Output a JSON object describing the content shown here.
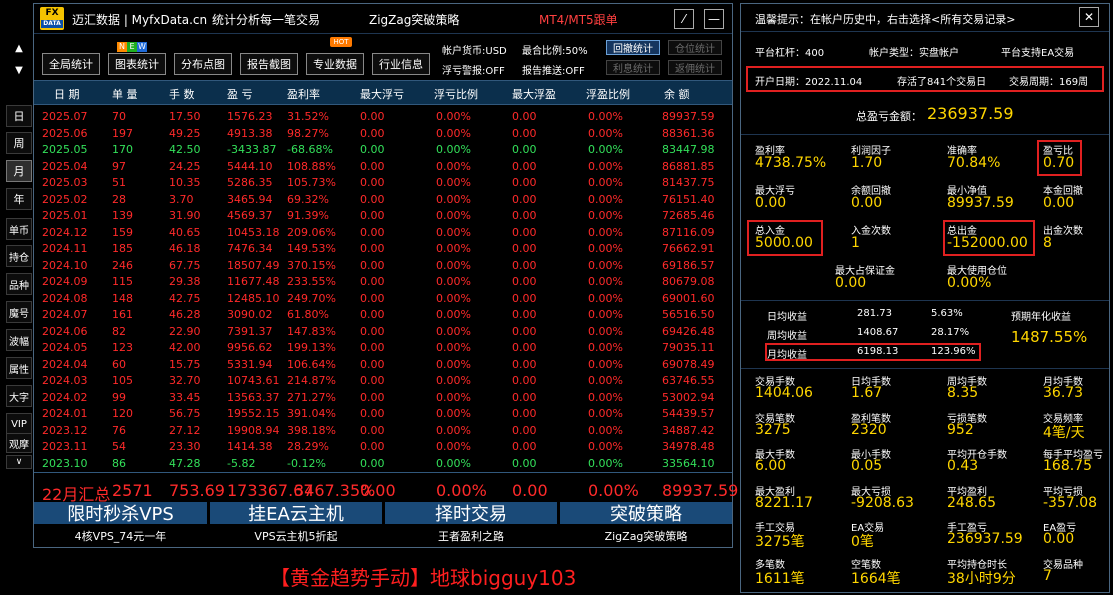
{
  "nav": {
    "up": "▲",
    "down": "▼",
    "items": [
      "日",
      "周",
      "月",
      "年",
      "单币",
      "持仓",
      "品种",
      "魔号",
      "波幅",
      "属性",
      "大字",
      "VIP",
      "观摩"
    ],
    "more": "∨"
  },
  "title": {
    "brand": "迈汇数据 | MyfxData.cn",
    "slogan": "统计分析每一笔交易",
    "strategy": "ZigZag突破策略",
    "mt": "MT4/MT5跟单",
    "minimize": "⁄",
    "maximize": "—"
  },
  "logo": {
    "top": "FX",
    "bottom": "DATA"
  },
  "toolbar": {
    "buttons": [
      "全局统计",
      "图表统计",
      "分布点图",
      "报告截图",
      "专业数据",
      "行业信息"
    ],
    "new_badge": [
      "N",
      "E",
      "W"
    ],
    "hot_badge": "HOT",
    "currency": "帐户货币:USD",
    "ratio": "最合比例:50%",
    "floatwarn": "浮亏警报:OFF",
    "report": "报告推送:OFF",
    "small_buttons": [
      "回撤统计",
      "仓位统计",
      "利息统计",
      "返佣统计"
    ]
  },
  "table": {
    "headers": [
      "日 期",
      "单 量",
      "手 数",
      "盈 亏",
      "盈利率",
      "最大浮亏",
      "浮亏比例",
      "最大浮盈",
      "浮盈比例",
      "余 额"
    ],
    "rows": [
      [
        "2025.07",
        "70",
        "17.50",
        "1576.23",
        "31.52%",
        "0.00",
        "0.00%",
        "0.00",
        "0.00%",
        "89937.59",
        "red"
      ],
      [
        "2025.06",
        "197",
        "49.25",
        "4913.38",
        "98.27%",
        "0.00",
        "0.00%",
        "0.00",
        "0.00%",
        "88361.36",
        "red"
      ],
      [
        "2025.05",
        "170",
        "42.50",
        "-3433.87",
        "-68.68%",
        "0.00",
        "0.00%",
        "0.00",
        "0.00%",
        "83447.98",
        "green"
      ],
      [
        "2025.04",
        "97",
        "24.25",
        "5444.10",
        "108.88%",
        "0.00",
        "0.00%",
        "0.00",
        "0.00%",
        "86881.85",
        "red"
      ],
      [
        "2025.03",
        "51",
        "10.35",
        "5286.35",
        "105.73%",
        "0.00",
        "0.00%",
        "0.00",
        "0.00%",
        "81437.75",
        "red"
      ],
      [
        "2025.02",
        "28",
        "3.70",
        "3465.94",
        "69.32%",
        "0.00",
        "0.00%",
        "0.00",
        "0.00%",
        "76151.40",
        "red"
      ],
      [
        "2025.01",
        "139",
        "31.90",
        "4569.37",
        "91.39%",
        "0.00",
        "0.00%",
        "0.00",
        "0.00%",
        "72685.46",
        "red"
      ],
      [
        "2024.12",
        "159",
        "40.65",
        "10453.18",
        "209.06%",
        "0.00",
        "0.00%",
        "0.00",
        "0.00%",
        "87116.09",
        "red"
      ],
      [
        "2024.11",
        "185",
        "46.18",
        "7476.34",
        "149.53%",
        "0.00",
        "0.00%",
        "0.00",
        "0.00%",
        "76662.91",
        "red"
      ],
      [
        "2024.10",
        "246",
        "67.75",
        "18507.49",
        "370.15%",
        "0.00",
        "0.00%",
        "0.00",
        "0.00%",
        "69186.57",
        "red"
      ],
      [
        "2024.09",
        "115",
        "29.38",
        "11677.48",
        "233.55%",
        "0.00",
        "0.00%",
        "0.00",
        "0.00%",
        "80679.08",
        "red"
      ],
      [
        "2024.08",
        "148",
        "42.75",
        "12485.10",
        "249.70%",
        "0.00",
        "0.00%",
        "0.00",
        "0.00%",
        "69001.60",
        "red"
      ],
      [
        "2024.07",
        "161",
        "46.28",
        "3090.02",
        "61.80%",
        "0.00",
        "0.00%",
        "0.00",
        "0.00%",
        "56516.50",
        "red"
      ],
      [
        "2024.06",
        "82",
        "22.90",
        "7391.37",
        "147.83%",
        "0.00",
        "0.00%",
        "0.00",
        "0.00%",
        "69426.48",
        "red"
      ],
      [
        "2024.05",
        "123",
        "42.00",
        "9956.62",
        "199.13%",
        "0.00",
        "0.00%",
        "0.00",
        "0.00%",
        "79035.11",
        "red"
      ],
      [
        "2024.04",
        "60",
        "15.75",
        "5331.94",
        "106.64%",
        "0.00",
        "0.00%",
        "0.00",
        "0.00%",
        "69078.49",
        "red"
      ],
      [
        "2024.03",
        "105",
        "32.70",
        "10743.61",
        "214.87%",
        "0.00",
        "0.00%",
        "0.00",
        "0.00%",
        "63746.55",
        "red"
      ],
      [
        "2024.02",
        "99",
        "33.45",
        "13563.37",
        "271.27%",
        "0.00",
        "0.00%",
        "0.00",
        "0.00%",
        "53002.94",
        "red"
      ],
      [
        "2024.01",
        "120",
        "56.75",
        "19552.15",
        "391.04%",
        "0.00",
        "0.00%",
        "0.00",
        "0.00%",
        "54439.57",
        "red"
      ],
      [
        "2023.12",
        "76",
        "27.12",
        "19908.94",
        "398.18%",
        "0.00",
        "0.00%",
        "0.00",
        "0.00%",
        "34887.42",
        "red"
      ],
      [
        "2023.11",
        "54",
        "23.30",
        "1414.38",
        "28.29%",
        "0.00",
        "0.00%",
        "0.00",
        "0.00%",
        "34978.48",
        "red"
      ],
      [
        "2023.10",
        "86",
        "47.28",
        "-5.82",
        "-0.12%",
        "0.00",
        "0.00%",
        "0.00",
        "0.00%",
        "33564.10",
        "green"
      ]
    ],
    "summary": [
      "22月汇总",
      "2571",
      "753.69",
      "173367.67",
      "3467.35%",
      "0.00",
      "0.00%",
      "0.00",
      "0.00%",
      "89937.59"
    ]
  },
  "promo": [
    {
      "title": "限时秒杀VPS",
      "sub": "4核VPS_74元一年"
    },
    {
      "title": "挂EA云主机",
      "sub": "VPS云主机5折起"
    },
    {
      "title": "择时交易",
      "sub": "王者盈利之路"
    },
    {
      "title": "突破策略",
      "sub": "ZigZag突破策略"
    }
  ],
  "bottom_text": "【黄金趋势手动】地球bigguy103",
  "right": {
    "tip": "温馨提示：在帐户历史中，右击选择<所有交易记录>",
    "close": "✕",
    "leverage": "平台杠杆：400",
    "account_type": "帐户类型：实盘帐户",
    "ea_support": "平台支持EA交易",
    "open_date": "开户日期：2022.11.04",
    "history": "存活了841个交易日",
    "cycle": "交易周期：169周",
    "total_profit_label": "总盈亏金额：",
    "total_profit": "236937.59",
    "grid1": [
      [
        "盈利率",
        "4738.75%"
      ],
      [
        "利润因子",
        "1.70"
      ],
      [
        "准确率",
        "70.84%"
      ],
      [
        "盈亏比",
        "0.70"
      ],
      [
        "最大浮亏",
        "0.00"
      ],
      [
        "余额回撤",
        "0.00"
      ],
      [
        "最小净值",
        "89937.59"
      ],
      [
        "本金回撤",
        "0.00"
      ],
      [
        "总入金",
        "5000.00"
      ],
      [
        "入金次数",
        "1"
      ],
      [
        "总出金",
        "-152000.00"
      ],
      [
        "出金次数",
        "8"
      ],
      [
        "最大占保证金",
        "0.00"
      ],
      [
        "最大使用仓位",
        "0.00%"
      ]
    ],
    "returns": [
      [
        "日均收益",
        "281.73",
        "5.63%"
      ],
      [
        "周均收益",
        "1408.67",
        "28.17%"
      ],
      [
        "月均收益",
        "6198.13",
        "123.96%"
      ]
    ],
    "annual_label": "预期年化收益",
    "annual": "1487.55%",
    "grid2": [
      [
        "交易手数",
        "1404.06"
      ],
      [
        "日均手数",
        "1.67"
      ],
      [
        "周均手数",
        "8.35"
      ],
      [
        "月均手数",
        "36.73"
      ],
      [
        "交易笔数",
        "3275"
      ],
      [
        "盈利笔数",
        "2320"
      ],
      [
        "亏损笔数",
        "952"
      ],
      [
        "交易频率",
        "4笔/天"
      ],
      [
        "最大手数",
        "6.00"
      ],
      [
        "最小手数",
        "0.05"
      ],
      [
        "平均开仓手数",
        "0.43"
      ],
      [
        "每手平均盈亏",
        "168.75"
      ],
      [
        "最大盈利",
        "8221.17"
      ],
      [
        "最大亏损",
        "-9208.63"
      ],
      [
        "平均盈利",
        "248.65"
      ],
      [
        "平均亏损",
        "-357.08"
      ],
      [
        "手工交易",
        "3275笔"
      ],
      [
        "EA交易",
        "0笔"
      ],
      [
        "手工盈亏",
        "236937.59"
      ],
      [
        "EA盈亏",
        "0.00"
      ],
      [
        "多笔数",
        "1611笔"
      ],
      [
        "空笔数",
        "1664笔"
      ],
      [
        "平均持仓时长",
        "38小时9分"
      ],
      [
        "交易品种",
        "7"
      ]
    ]
  },
  "colors": {
    "red": "#ff2a2a",
    "green": "#33e05a",
    "yellow": "#ffd600",
    "header_bg": "#0b2f4c",
    "promo_bg": "#1a4a78",
    "box_red": "#e02020"
  }
}
